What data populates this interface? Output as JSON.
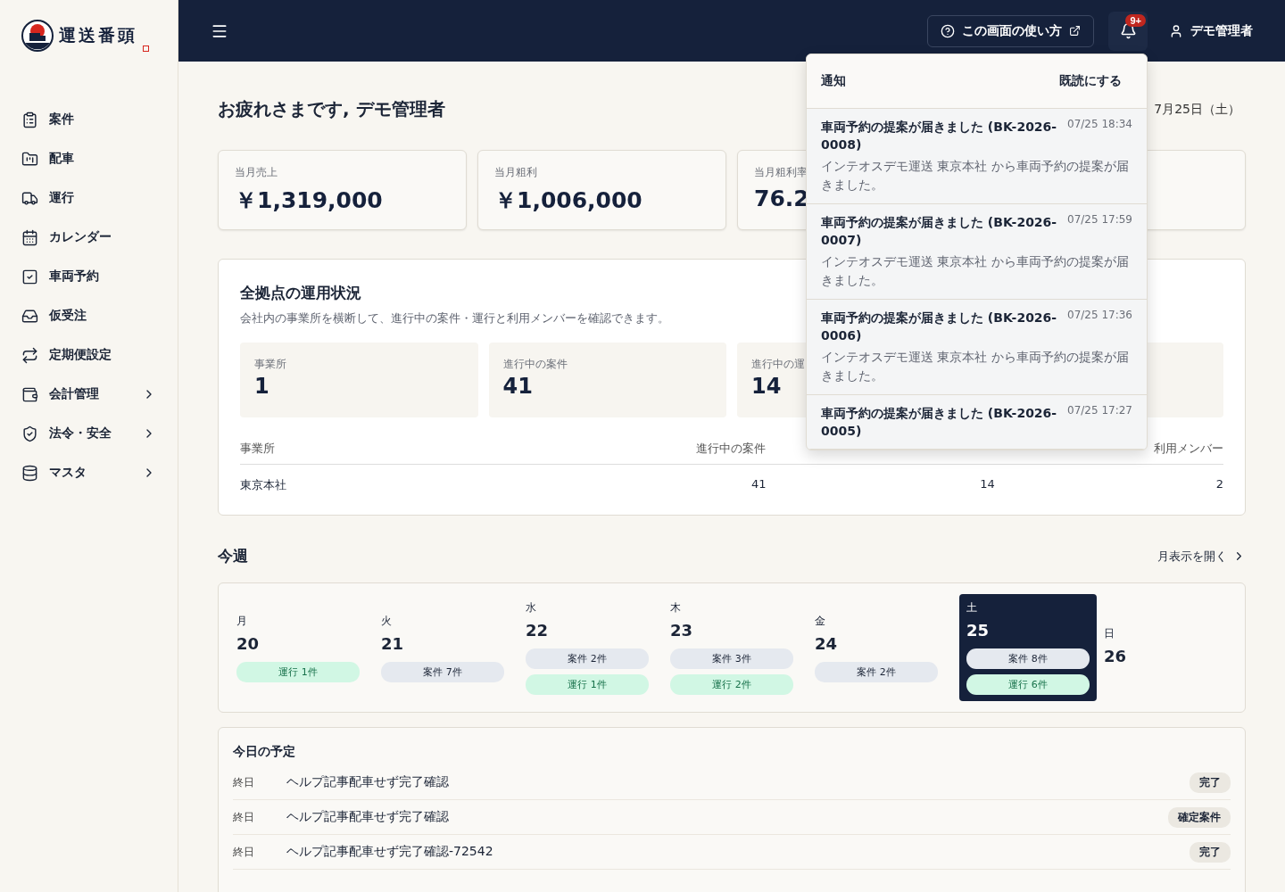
{
  "brand": {
    "name": "運送番頭"
  },
  "sidebar": {
    "items": [
      {
        "label": "案件",
        "expandable": false
      },
      {
        "label": "配車",
        "expandable": false
      },
      {
        "label": "運行",
        "expandable": false
      },
      {
        "label": "カレンダー",
        "expandable": false
      },
      {
        "label": "車両予約",
        "expandable": false
      },
      {
        "label": "仮受注",
        "expandable": false
      },
      {
        "label": "定期便設定",
        "expandable": false
      },
      {
        "label": "会計管理",
        "expandable": true
      },
      {
        "label": "法令・安全",
        "expandable": true
      },
      {
        "label": "マスタ",
        "expandable": true
      }
    ]
  },
  "header": {
    "help_button": "この画面の使い方",
    "notification_badge": "9+",
    "user": "デモ管理者"
  },
  "greeting": "お疲れさまです, デモ管理者",
  "date": "7月25日（土）",
  "stats": [
    {
      "label": "当月売上",
      "value": "￥1,319,000"
    },
    {
      "label": "当月粗利",
      "value": "￥1,006,000"
    },
    {
      "label": "当月粗利率",
      "value": "76.2"
    }
  ],
  "overview": {
    "title": "全拠点の運用状況",
    "description": "会社内の事業所を横断して、進行中の案件・運行と利用メンバーを確認できます。",
    "stats": [
      {
        "label": "事業所",
        "value": "1"
      },
      {
        "label": "進行中の案件",
        "value": "41"
      },
      {
        "label": "進行中の運",
        "value": "14"
      }
    ],
    "table": {
      "columns": [
        "事業所",
        "進行中の案件",
        null,
        "利用メンバー"
      ],
      "rows": [
        [
          "東京本社",
          "41",
          "14",
          "2"
        ]
      ]
    }
  },
  "week": {
    "title": "今週",
    "link": "月表示を開く",
    "days": [
      {
        "weekday": "月",
        "date": "20",
        "selected": false,
        "badges": [
          {
            "kind": "run",
            "label": "運行 1件"
          }
        ]
      },
      {
        "weekday": "火",
        "date": "21",
        "selected": false,
        "badges": [
          {
            "kind": "case",
            "label": "案件 7件"
          }
        ]
      },
      {
        "weekday": "水",
        "date": "22",
        "selected": false,
        "badges": [
          {
            "kind": "case",
            "label": "案件 2件"
          },
          {
            "kind": "run",
            "label": "運行 1件"
          }
        ]
      },
      {
        "weekday": "木",
        "date": "23",
        "selected": false,
        "badges": [
          {
            "kind": "case",
            "label": "案件 3件"
          },
          {
            "kind": "run",
            "label": "運行 2件"
          }
        ]
      },
      {
        "weekday": "金",
        "date": "24",
        "selected": false,
        "badges": [
          {
            "kind": "case",
            "label": "案件 2件"
          }
        ]
      },
      {
        "weekday": "土",
        "date": "25",
        "selected": true,
        "badges": [
          {
            "kind": "case",
            "label": "案件 8件"
          },
          {
            "kind": "run",
            "label": "運行 6件"
          }
        ]
      },
      {
        "weekday": "日",
        "date": "26",
        "selected": false
      }
    ]
  },
  "today": {
    "title": "今日の予定",
    "items": [
      {
        "time": "終日",
        "title": "ヘルプ記事配車せず完了確認",
        "status": "完了"
      },
      {
        "time": "終日",
        "title": "ヘルプ記事配車せず完了確認",
        "status": "確定案件"
      },
      {
        "time": "終日",
        "title": "ヘルプ記事配車せず完了確認-72542",
        "status": "完了"
      }
    ]
  },
  "notifications": {
    "title": "通知",
    "mark_read": "既読にする",
    "items": [
      {
        "title": "車両予約の提案が届きました (BK-2026-0008)",
        "time": "07/25 18:34",
        "message": "インテオスデモ運送 東京本社 から車両予約の提案が届きました。"
      },
      {
        "title": "車両予約の提案が届きました (BK-2026-0007)",
        "time": "07/25 17:59",
        "message": "インテオスデモ運送 東京本社 から車両予約の提案が届きました。"
      },
      {
        "title": "車両予約の提案が届きました (BK-2026-0006)",
        "time": "07/25 17:36",
        "message": "インテオスデモ運送 東京本社 から車両予約の提案が届きました。"
      },
      {
        "title": "車両予約の提案が届きました (BK-2026-0005)",
        "time": "07/25 17:27"
      }
    ]
  }
}
